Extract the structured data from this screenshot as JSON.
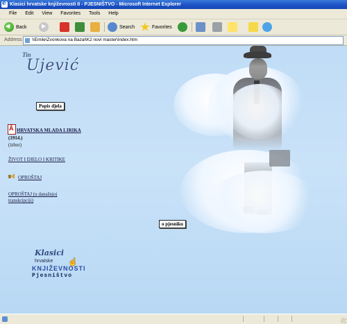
{
  "window": {
    "title": "Klasici hrvatske književnosti II - PJESNIŠTVO - Microsoft Internet Explorer"
  },
  "menu": [
    "File",
    "Edit",
    "View",
    "Favorites",
    "Tools",
    "Help"
  ],
  "toolbar": {
    "back": "Back",
    "search": "Search",
    "favorites": "Favorites"
  },
  "address": {
    "label": "Address",
    "url": "\\\\Emile\\Zvonkova na Bazal\\K2 novi master\\index.htm"
  },
  "logo": {
    "tin": "Tin",
    "ujevic": "Ujević"
  },
  "page": {
    "popis_djela": "Popis djela",
    "work_title": "HRVATSKA MLADA LIRIKA",
    "work_year": "(1914.)",
    "work_note": "(izbor)",
    "link_zivot": "ŽIVOT I DJELO I KRITIKE",
    "audio_link": "OPROŠTAJ",
    "link_oprostaj_line1": "OPROŠTAJ (u današnjoj",
    "link_oprostaj_line2": "transkripciji)",
    "o_pjesniku": "o pjesniku"
  },
  "bottom_logo": {
    "line1": "Klasici",
    "line2": "hrvatske",
    "line3": "KNJIŽEVNOSTI",
    "line4": "Pjesništvo"
  },
  "icons": [
    "ie-icon",
    "back-icon",
    "forward-icon",
    "stop-icon",
    "refresh-icon",
    "home-icon",
    "search-icon",
    "favorites-icon",
    "media-icon",
    "mail-icon",
    "print-icon",
    "edit-icon",
    "messenger-icon",
    "pdf-icon",
    "speaker-icon",
    "hand-cursor-icon"
  ]
}
